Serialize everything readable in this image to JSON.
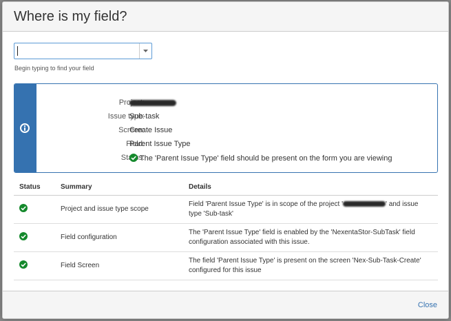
{
  "dialog": {
    "title": "Where is my field?",
    "search": {
      "value": "",
      "placeholder": ""
    },
    "hint": "Begin typing to find your field"
  },
  "info": {
    "rows": [
      {
        "key": "Project:",
        "value": ""
      },
      {
        "key": "Issue type:",
        "value": "Sub-task"
      },
      {
        "key": "Screen:",
        "value": "Create Issue"
      },
      {
        "key": "Field:",
        "value": "Parent Issue Type"
      },
      {
        "key": "Status:",
        "value": "The 'Parent Issue Type' field should be present on the form you are viewing"
      }
    ]
  },
  "table": {
    "headers": [
      "Status",
      "Summary",
      "Details"
    ],
    "rows": [
      {
        "status": "ok",
        "summary": "Project and issue type scope",
        "details_pre": "Field 'Parent Issue Type' is in scope of the project '",
        "details_post": "' and issue type 'Sub-task'"
      },
      {
        "status": "ok",
        "summary": "Field configuration",
        "details": "The 'Parent Issue Type' field is enabled by the 'NexentaStor-SubTask' field configuration associated with this issue."
      },
      {
        "status": "ok",
        "summary": "Field Screen",
        "details": "The field 'Parent Issue Type' is present on the screen 'Nex-Sub-Task-Create' configured for this issue"
      }
    ]
  },
  "footer": {
    "close_label": "Close"
  },
  "colors": {
    "accent": "#3572b0",
    "success": "#14892c"
  }
}
